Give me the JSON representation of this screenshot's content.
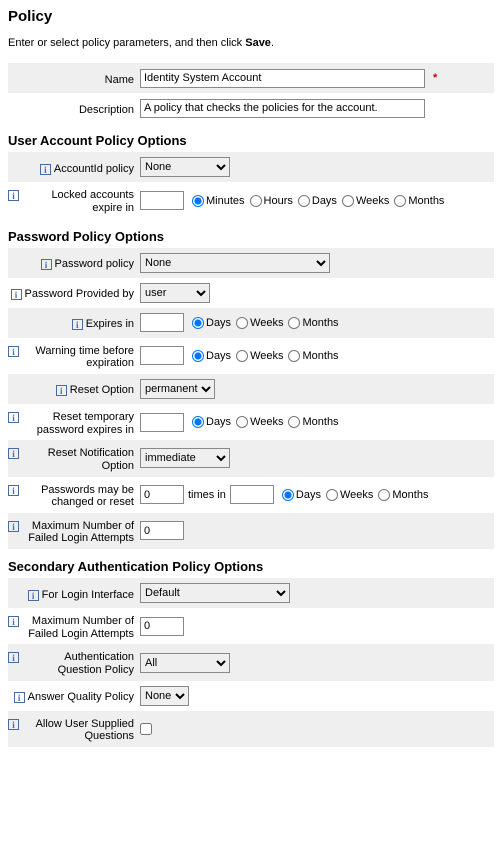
{
  "page": {
    "title": "Policy",
    "intro_prefix": "Enter or select policy parameters, and then click ",
    "intro_bold": "Save",
    "intro_suffix": "."
  },
  "info_glyph": "i",
  "required_mark": "*",
  "fields": {
    "name_label": "Name",
    "name_value": "Identity System Account",
    "desc_label": "Description",
    "desc_value": "A policy that checks the policies for the account."
  },
  "sections": {
    "user": "User Account Policy Options",
    "pwd": "Password Policy Options",
    "sec": "Secondary Authentication Policy Options"
  },
  "user": {
    "accountid_label": "AccountId policy",
    "accountid_value": "None",
    "locked_label": "Locked accounts expire in"
  },
  "pwd": {
    "policy_label": "Password policy",
    "policy_value": "None",
    "provided_label": "Password Provided by",
    "provided_value": "user",
    "expires_label": "Expires in",
    "warn_label": "Warning time before expiration",
    "reset_opt_label": "Reset Option",
    "reset_opt_value": "permanent",
    "reset_temp_label": "Reset temporary password expires in",
    "reset_notif_label": "Reset Notification Option",
    "reset_notif_value": "immediate",
    "changes_label": "Passwords may be changed or reset",
    "changes_value": "0",
    "changes_mid": "times in",
    "maxfail_label": "Maximum Number of Failed Login Attempts",
    "maxfail_value": "0"
  },
  "sec": {
    "login_label": "For Login Interface",
    "login_value": "Default",
    "maxfail_label": "Maximum Number of Failed Login Attempts",
    "maxfail_value": "0",
    "authq_label": "Authentication Question Policy",
    "authq_value": "All",
    "ansq_label": "Answer Quality Policy",
    "ansq_value": "None",
    "allow_label": "Allow User Supplied Questions"
  },
  "units5": {
    "min": "Minutes",
    "hr": "Hours",
    "day": "Days",
    "wk": "Weeks",
    "mo": "Months"
  },
  "units3": {
    "day": "Days",
    "wk": "Weeks",
    "mo": "Months"
  }
}
